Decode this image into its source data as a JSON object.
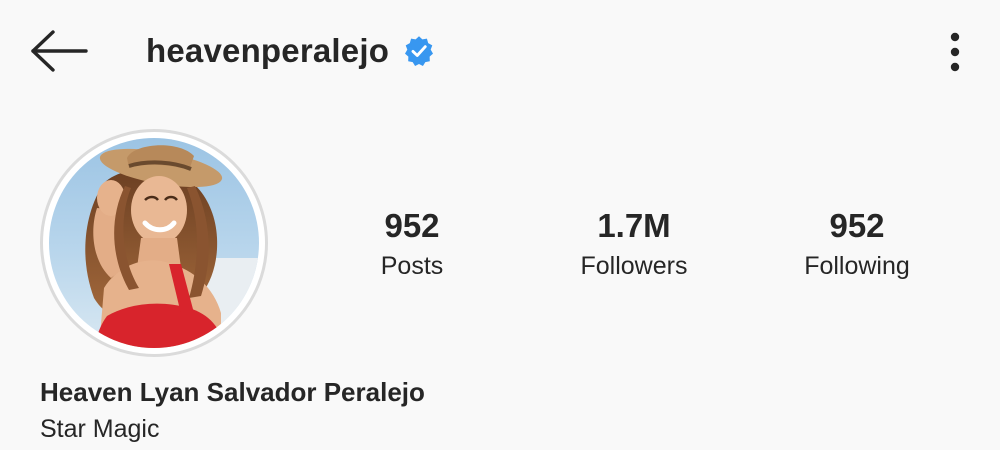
{
  "header": {
    "username": "heavenperalejo",
    "verified": true,
    "icons": {
      "back": "back-arrow-icon",
      "verified": "verified-badge-icon",
      "more": "more-vertical-icon"
    }
  },
  "profile": {
    "avatar_icon": "profile-photo",
    "stats": {
      "posts": {
        "value": "952",
        "label": "Posts"
      },
      "followers": {
        "value": "1.7M",
        "label": "Followers"
      },
      "following": {
        "value": "952",
        "label": "Following"
      }
    },
    "full_name": "Heaven Lyan Salvador Peralejo",
    "category": "Star Magic"
  },
  "colors": {
    "background": "#f9f9f9",
    "text": "#262626",
    "verified_blue": "#3897f0",
    "avatar_ring": "#dbdbdb"
  }
}
